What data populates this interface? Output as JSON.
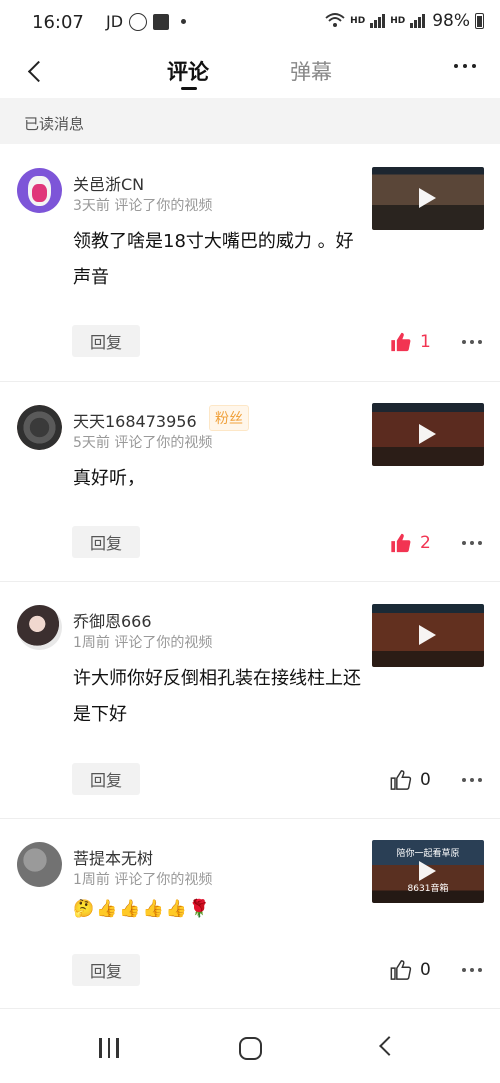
{
  "status": {
    "time": "16:07",
    "carrier": "JD",
    "network_labels": [
      "HD",
      "HD"
    ],
    "battery": "98%"
  },
  "header": {
    "tabs": [
      {
        "label": "评论",
        "active": true
      },
      {
        "label": "弹幕",
        "active": false
      }
    ]
  },
  "banner": {
    "label": "已读消息"
  },
  "comments": [
    {
      "user": "关邑浙CN",
      "meta": "3天前 评论了你的视频",
      "text": "领教了啥是18寸大嘴巴的威力 。好声音",
      "reply": "回复",
      "likes": "1",
      "liked": true
    },
    {
      "user": "天天168473956",
      "badge": "粉丝",
      "meta": "5天前 评论了你的视频",
      "text": "真好听，",
      "reply": "回复",
      "likes": "2",
      "liked": true
    },
    {
      "user": "乔御恩666",
      "meta": "1周前 评论了你的视频",
      "text": "许大师你好反倒相孔装在接线柱上还是下好",
      "reply": "回复",
      "likes": "0",
      "liked": false
    },
    {
      "user": "菩提本无树",
      "meta": "1周前 评论了你的视频",
      "text": "🤔👍👍👍👍🌹",
      "reply": "回复",
      "likes": "0",
      "liked": false,
      "thumb_caption": "陪你一起看草原",
      "thumb_caption2": "8631音箱"
    }
  ],
  "colors": {
    "accent": "#f23452",
    "badge": "#f0a13c"
  }
}
